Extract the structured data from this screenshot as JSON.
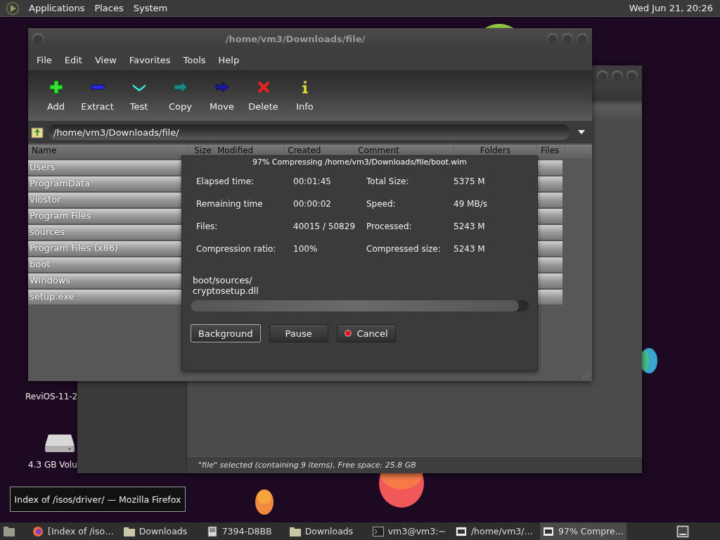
{
  "top_panel": {
    "menus": [
      "Applications",
      "Places",
      "System"
    ],
    "clock": "Wed Jun 21, 20:26"
  },
  "desktop_icons": [
    {
      "label": "ReviOS-11-2",
      "kind": "hidden"
    },
    {
      "label": "4.3 GB Volu",
      "kind": "drive"
    }
  ],
  "file_manager": {
    "status": "\"file\" selected (containing 9 items), Free space: 25.8 GB"
  },
  "archiver": {
    "title": "/home/vm3/Downloads/file/",
    "menu": [
      "File",
      "Edit",
      "View",
      "Favorites",
      "Tools",
      "Help"
    ],
    "toolbar": [
      {
        "label": "Add",
        "kind": "add"
      },
      {
        "label": "Extract",
        "kind": "extract"
      },
      {
        "label": "Test",
        "kind": "test"
      },
      {
        "label": "Copy",
        "kind": "copy"
      },
      {
        "label": "Move",
        "kind": "move"
      },
      {
        "label": "Delete",
        "kind": "delete"
      },
      {
        "label": "Info",
        "kind": "info"
      }
    ],
    "path": "/home/vm3/Downloads/file/",
    "columns": [
      "Name",
      "Size",
      "Modified",
      "Created",
      "Comment",
      "Folders",
      "Files"
    ],
    "rows": [
      "Users",
      "ProgramData",
      "viostor",
      "Program Files",
      "sources",
      "Program Files (x86)",
      "boot",
      "Windows",
      "setup.exe"
    ]
  },
  "progress_dialog": {
    "title": "97% Compressing /home/vm3/Downloads/file/boot.wim",
    "stats": [
      {
        "label": "Elapsed time:",
        "value": "00:01:45"
      },
      {
        "label": "Total Size:",
        "value": "5375 M"
      },
      {
        "label": "Remaining time",
        "value": "00:00:02"
      },
      {
        "label": "Speed:",
        "value": "49 MB/s"
      },
      {
        "label": "Files:",
        "value": "40015 / 50829"
      },
      {
        "label": "Processed:",
        "value": "5243 M"
      },
      {
        "label": "Compression ratio:",
        "value": "100%"
      },
      {
        "label": "Compressed size:",
        "value": "5243 M"
      }
    ],
    "current_file": [
      "boot/sources/",
      "cryptosetup.dll"
    ],
    "level": 0.97,
    "buttons": [
      {
        "label": "Background",
        "kind": "focused"
      },
      {
        "label": "Pause",
        "kind": "plain"
      },
      {
        "label": "Cancel",
        "kind": "stop"
      }
    ]
  },
  "tooltip": "Index of /isos/driver/ — Mozilla Firefox",
  "taskbar": {
    "items": [
      {
        "label": "[Index of /iso…",
        "kind": "browser",
        "selected": false
      },
      {
        "label": "Downloads",
        "kind": "folder",
        "selected": false
      },
      {
        "label": "7394-D8BB",
        "kind": "drive",
        "selected": false
      },
      {
        "label": "Downloads",
        "kind": "folder",
        "selected": false
      },
      {
        "label": "vm3@vm3:~",
        "kind": "terminal",
        "selected": false
      },
      {
        "label": "/home/vm3/…",
        "kind": "archive",
        "selected": false
      },
      {
        "label": "97% Compre…",
        "kind": "archive",
        "selected": true
      }
    ]
  }
}
